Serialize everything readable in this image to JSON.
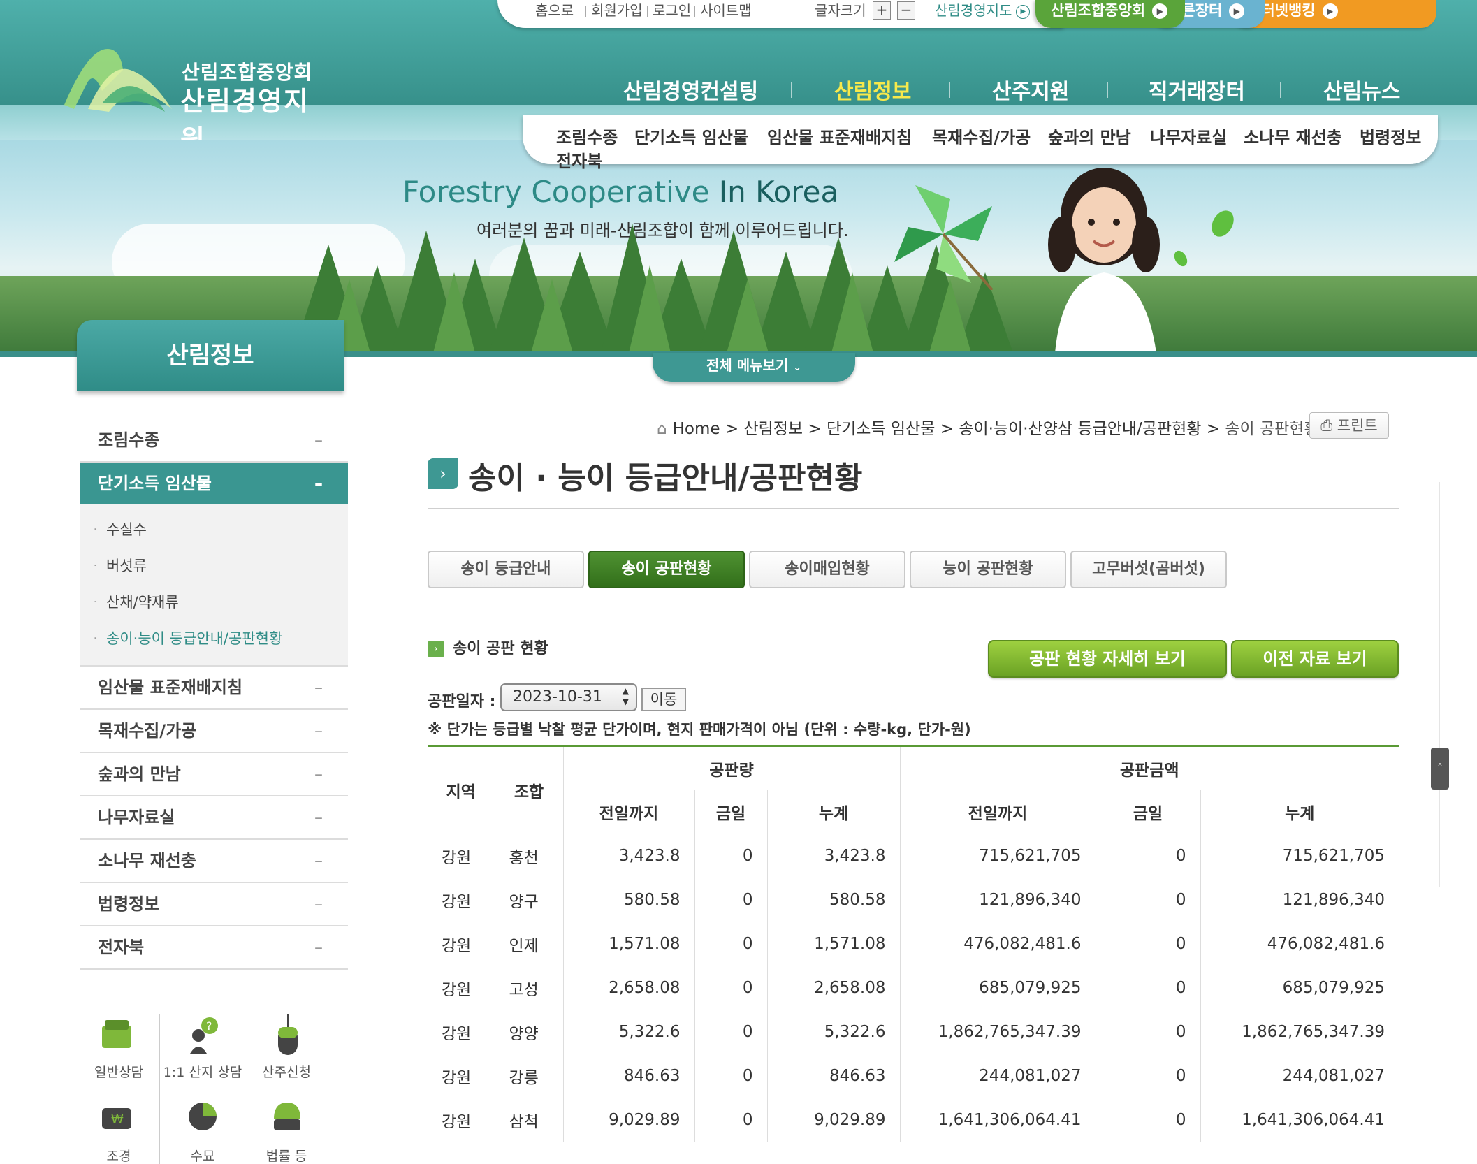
{
  "util": {
    "links": [
      "홈으로",
      "회원가입",
      "로그인",
      "사이트맵"
    ],
    "font_size_label": "글자크기",
    "font_plus": "+",
    "font_minus": "−",
    "map_label": "산림경영지도",
    "tabs": [
      "산림조합중앙회",
      "푸른장터",
      "인터넷뱅킹"
    ]
  },
  "logo": {
    "line1": "산림조합중앙회",
    "line2": "산림경영지원"
  },
  "gnb": [
    "산림경영컨설팅",
    "산림정보",
    "산주지원",
    "직거래장터",
    "산림뉴스"
  ],
  "gnb_active_index": 1,
  "submenu": [
    "조림수종",
    "단기소득 임산물",
    "임산물 표준재배지침",
    "목재수집/가공",
    "숲과의 만남",
    "나무자료실",
    "소나무 재선충",
    "법령정보",
    "전자북"
  ],
  "banner": {
    "title_a": "Forestry Cooperative ",
    "title_b": "In Korea",
    "subtitle": "여러분의 꿈과 미래-산림조합이 함께 이루어드립니다."
  },
  "all_menu_label": "전체 메뉴보기",
  "lnb": {
    "title": "산림정보",
    "items": [
      "조림수종",
      "단기소득 임산물",
      "임산물 표준재배지침",
      "목재수집/가공",
      "숲과의 만남",
      "나무자료실",
      "소나무 재선충",
      "법령정보",
      "전자북"
    ],
    "sub_items": [
      "수실수",
      "버섯류",
      "산채/약재류",
      "송이·능이 등급안내/공판현황"
    ]
  },
  "quick": [
    "일반상담",
    "1:1 산지 상담",
    "산주신청",
    "조경",
    "수묘",
    "법률 등"
  ],
  "location": {
    "home": "Home",
    "path": [
      "산림정보",
      "단기소득 임산물",
      "송이·능이·산양삼 등급안내/공판현황"
    ],
    "current": "송이 공판현황",
    "print_label": "프린트"
  },
  "page_title": "송이 · 능이 등급안내/공판현황",
  "tabs": [
    "송이 등급안내",
    "송이 공판현황",
    "송이매입현황",
    "능이 공판현황",
    "고무버섯(곰버섯)"
  ],
  "tabs_active_index": 1,
  "section_title": "송이 공판 현황",
  "buttons": {
    "detail": "공판 현황 자세히 보기",
    "prev": "이전 자료 보기"
  },
  "date": {
    "label": "공판일자 :",
    "value": "2023-10-31",
    "go": "이동"
  },
  "notice": "※ 단가는 등급별 낙찰 평균 단가이며, 현지 판매가격이 아님 (단위 : 수량-kg, 단가-원)",
  "table": {
    "h_region": "지역",
    "h_union": "조합",
    "h_qty": "공판량",
    "h_amt": "공판금액",
    "h_prev": "전일까지",
    "h_today": "금일",
    "h_total": "누계",
    "rows": [
      [
        "강원",
        "홍천",
        "3,423.8",
        "0",
        "3,423.8",
        "715,621,705",
        "0",
        "715,621,705"
      ],
      [
        "강원",
        "양구",
        "580.58",
        "0",
        "580.58",
        "121,896,340",
        "0",
        "121,896,340"
      ],
      [
        "강원",
        "인제",
        "1,571.08",
        "0",
        "1,571.08",
        "476,082,481.6",
        "0",
        "476,082,481.6"
      ],
      [
        "강원",
        "고성",
        "2,658.08",
        "0",
        "2,658.08",
        "685,079,925",
        "0",
        "685,079,925"
      ],
      [
        "강원",
        "양양",
        "5,322.6",
        "0",
        "5,322.6",
        "1,862,765,347.39",
        "0",
        "1,862,765,347.39"
      ],
      [
        "강원",
        "강릉",
        "846.63",
        "0",
        "846.63",
        "244,081,027",
        "0",
        "244,081,027"
      ],
      [
        "강원",
        "삼척",
        "9,029.89",
        "0",
        "9,029.89",
        "1,641,306,064.41",
        "0",
        "1,641,306,064.41"
      ]
    ]
  },
  "colors": {
    "teal": "#3e9893",
    "green_active": "#3f7f22",
    "green_btn": "#8cc63f",
    "gnb_active": "#f7e94b"
  }
}
